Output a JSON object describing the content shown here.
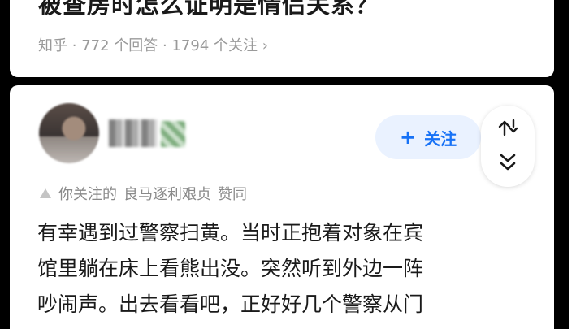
{
  "question": {
    "title": "被查房时怎么证明是情侣关系？",
    "source": "知乎",
    "answers_count": "772 个回答",
    "followers_count": "1794 个关注",
    "separator": "·",
    "chevron": "›"
  },
  "answer": {
    "author_name": "",
    "follow_button": {
      "plus": "+",
      "label": "关注"
    },
    "liked_by_prefix": "你关注的",
    "liked_by_user": "良马逐利艰贞",
    "liked_by_suffix": "赞同",
    "body_lines": [
      "有幸遇到过警察扫黄。当时正抱着对象在宾",
      "馆里躺在床上看熊出没。突然听到外边一阵",
      "吵闹声。出去看看吧，正好好几个警察从门"
    ]
  },
  "colors": {
    "accent": "#1772f6",
    "follow_bg": "#eaf2ff",
    "muted_text": "#9a9a9a",
    "body_text": "#1a1a1a"
  },
  "icons": [
    "share-icon",
    "collapse-icon",
    "triangle-icon"
  ]
}
